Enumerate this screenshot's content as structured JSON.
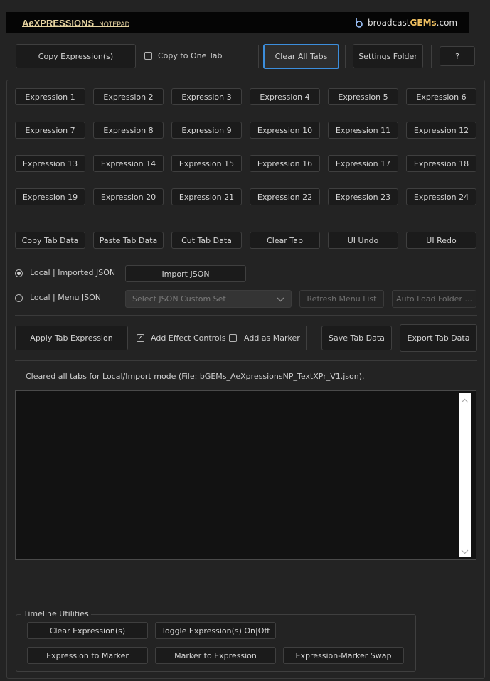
{
  "header": {
    "logo_main": "AeXPRESSIONS",
    "logo_sub": "NOTEPAD",
    "brand_prefix": "broadcast",
    "brand_bold": "GEMs",
    "brand_suffix": ".com"
  },
  "toolbar": {
    "copy_expressions": "Copy Expression(s)",
    "copy_to_one_tab": "Copy to One Tab",
    "clear_all_tabs": "Clear All Tabs",
    "settings_folder": "Settings Folder",
    "help": "?"
  },
  "expressions": [
    "Expression 1",
    "Expression 2",
    "Expression 3",
    "Expression 4",
    "Expression 5",
    "Expression 6",
    "Expression 7",
    "Expression 8",
    "Expression 9",
    "Expression 10",
    "Expression 11",
    "Expression 12",
    "Expression 13",
    "Expression 14",
    "Expression 15",
    "Expression 16",
    "Expression 17",
    "Expression 18",
    "Expression 19",
    "Expression 20",
    "Expression 21",
    "Expression 22",
    "Expression 23",
    "Expression 24"
  ],
  "tab_actions": {
    "copy": "Copy Tab Data",
    "paste": "Paste Tab Data",
    "cut": "Cut Tab Data",
    "clear": "Clear Tab",
    "undo": "UI Undo",
    "redo": "UI Redo"
  },
  "json_source": {
    "local_imported": "Local | Imported JSON",
    "import_button": "Import JSON",
    "local_menu": "Local | Menu JSON",
    "select_placeholder": "Select JSON Custom Set",
    "refresh": "Refresh Menu List",
    "auto_load": "Auto Load Folder ..."
  },
  "apply_row": {
    "apply": "Apply Tab Expression",
    "add_effect_controls": "Add Effect Controls",
    "add_as_marker": "Add as Marker",
    "save": "Save Tab Data",
    "export": "Export Tab Data"
  },
  "status_text": "Cleared all tabs for Local/Import mode (File: bGEMs_AeXpressionsNP_TextXPr_V1.json).",
  "editor": {
    "content": ""
  },
  "timeline": {
    "title": "Timeline Utilities",
    "clear_expressions": "Clear Expression(s)",
    "toggle": "Toggle Expression(s) On|Off",
    "expr_to_marker": "Expression to Marker",
    "marker_to_expr": "Marker to Expression",
    "swap": "Expression-Marker Swap"
  },
  "colors": {
    "logo_accent": "#e6d3a0",
    "brand_bold": "#f0c060",
    "selected_outline": "#3c8edc"
  }
}
